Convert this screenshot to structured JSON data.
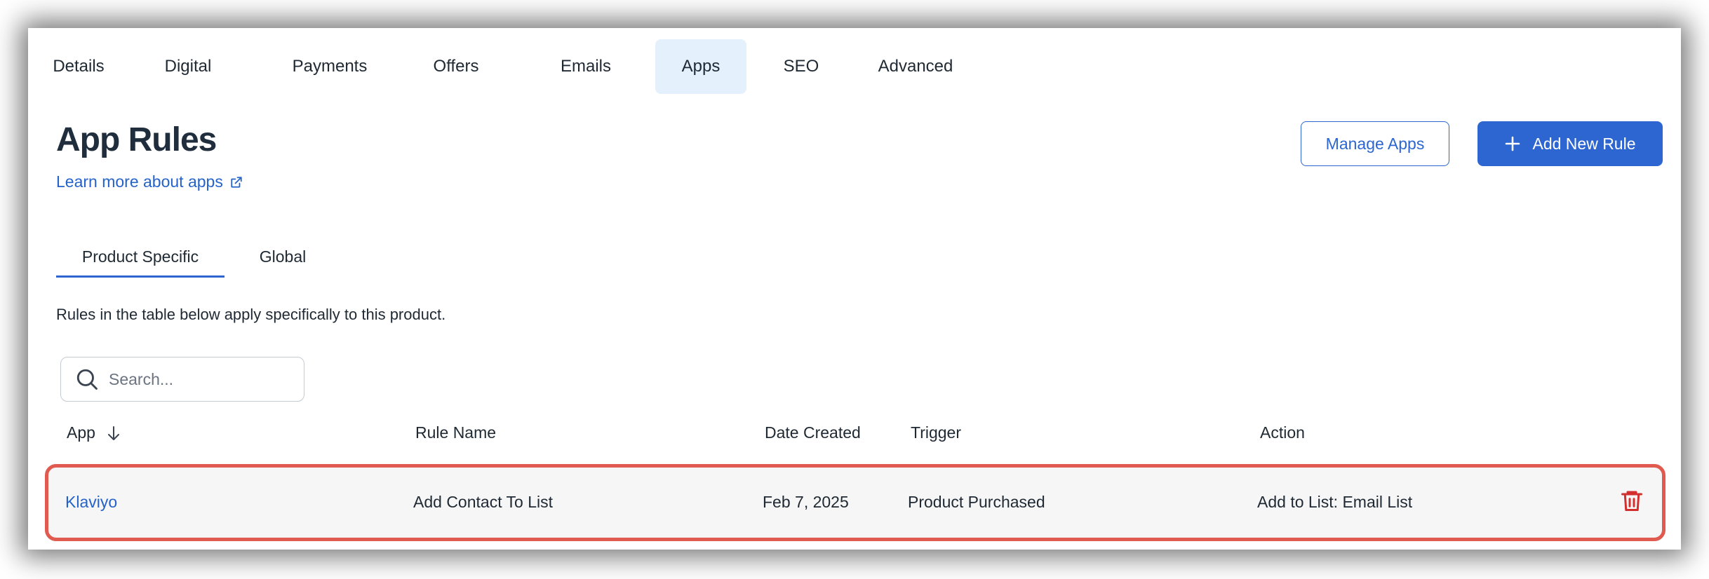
{
  "nav": {
    "tabs": [
      {
        "label": "Details"
      },
      {
        "label": "Digital"
      },
      {
        "label": "Payments"
      },
      {
        "label": "Offers"
      },
      {
        "label": "Emails"
      },
      {
        "label": "Apps",
        "active": true
      },
      {
        "label": "SEO"
      },
      {
        "label": "Advanced"
      }
    ]
  },
  "page": {
    "title": "App Rules",
    "learn_link": "Learn more about apps",
    "manage_button": "Manage Apps",
    "add_button": "Add New Rule",
    "description": "Rules in the table below apply specifically to this product."
  },
  "subtabs": [
    {
      "label": "Product Specific",
      "active": true
    },
    {
      "label": "Global"
    }
  ],
  "search": {
    "placeholder": "Search...",
    "value": ""
  },
  "table": {
    "headers": [
      "App",
      "Rule Name",
      "Date Created",
      "Trigger",
      "Action"
    ],
    "sort_icon": "arrow-down-icon",
    "rows": [
      {
        "app": "Klaviyo",
        "rule_name": "Add Contact To List",
        "date_created": "Feb 7, 2025",
        "trigger": "Product Purchased",
        "action": "Add to List: Email List"
      }
    ]
  },
  "colors": {
    "accent": "#2d66d0",
    "active_tab_bg": "#e4f0fb",
    "highlight_border": "#e05a4f",
    "delete": "#d32f2f"
  }
}
